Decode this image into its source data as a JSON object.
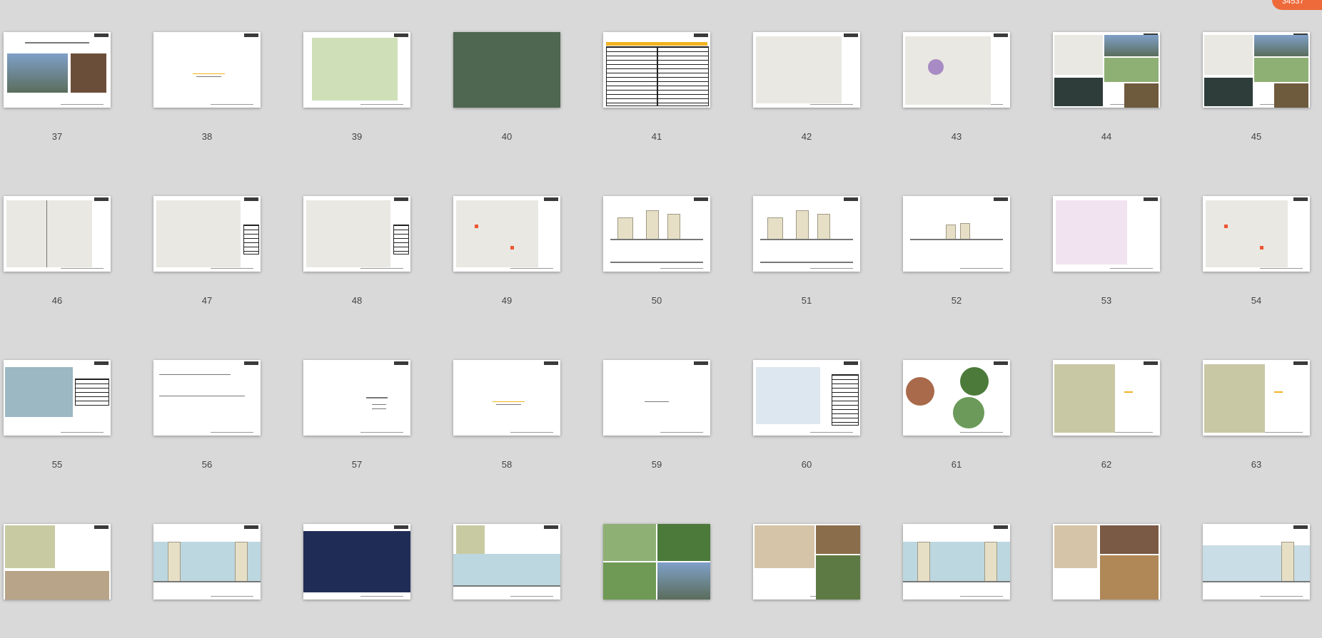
{
  "badge": {
    "label": "34537"
  },
  "slides": [
    {
      "n": "37",
      "kind": "photos"
    },
    {
      "n": "38",
      "kind": "title"
    },
    {
      "n": "39",
      "kind": "plan-green"
    },
    {
      "n": "40",
      "kind": "aerial"
    },
    {
      "n": "41",
      "kind": "table"
    },
    {
      "n": "42",
      "kind": "plan-dots"
    },
    {
      "n": "43",
      "kind": "plan-purple"
    },
    {
      "n": "44",
      "kind": "plan-photos"
    },
    {
      "n": "45",
      "kind": "plan-photos"
    },
    {
      "n": "46",
      "kind": "plan-lines"
    },
    {
      "n": "47",
      "kind": "plan-legend"
    },
    {
      "n": "48",
      "kind": "plan-legend"
    },
    {
      "n": "49",
      "kind": "plan-red"
    },
    {
      "n": "50",
      "kind": "section"
    },
    {
      "n": "51",
      "kind": "section"
    },
    {
      "n": "52",
      "kind": "section-single"
    },
    {
      "n": "53",
      "kind": "plan-color"
    },
    {
      "n": "54",
      "kind": "plan-red"
    },
    {
      "n": "55",
      "kind": "plan-table"
    },
    {
      "n": "56",
      "kind": "drawing"
    },
    {
      "n": "57",
      "kind": "chapter"
    },
    {
      "n": "58",
      "kind": "title"
    },
    {
      "n": "59",
      "kind": "title-small"
    },
    {
      "n": "60",
      "kind": "diagram"
    },
    {
      "n": "61",
      "kind": "bubbles"
    },
    {
      "n": "62",
      "kind": "plan-text"
    },
    {
      "n": "63",
      "kind": "plan-text"
    },
    {
      "n": "",
      "kind": "plan-photos-low"
    },
    {
      "n": "",
      "kind": "section-sky"
    },
    {
      "n": "",
      "kind": "night"
    },
    {
      "n": "",
      "kind": "plan-section"
    },
    {
      "n": "",
      "kind": "landscape"
    },
    {
      "n": "",
      "kind": "plan-photos2"
    },
    {
      "n": "",
      "kind": "section-sky"
    },
    {
      "n": "",
      "kind": "plan-photos3"
    },
    {
      "n": "",
      "kind": "section-plain"
    }
  ],
  "colors": {
    "background": "#d9d9d9",
    "badge": "#ee6a3a",
    "slide": "#ffffff"
  }
}
